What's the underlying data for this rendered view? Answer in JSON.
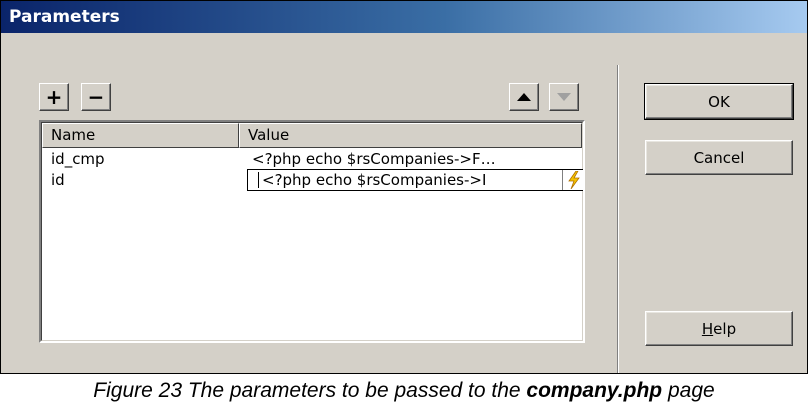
{
  "dialog": {
    "title": "Parameters",
    "buttons": {
      "ok": "OK",
      "cancel": "Cancel",
      "help_underlined": "H",
      "help_rest": "elp"
    },
    "toolbar": {
      "add_label": "+",
      "remove_label": "−",
      "up_icon": "up-arrow-icon",
      "down_icon": "down-arrow-icon"
    },
    "grid": {
      "columns": [
        "Name",
        "Value"
      ],
      "rows": [
        {
          "name": "id_cmp",
          "value": "<?php echo $rsCompanies->F…"
        },
        {
          "name": "id",
          "value": "<?php echo $rsCompanies->I"
        }
      ],
      "edit_icon": "lightning-bolt-icon"
    }
  },
  "caption": {
    "prefix": "Figure 23 The parameters to be passed to the ",
    "bold": "company.php",
    "suffix": " page"
  }
}
